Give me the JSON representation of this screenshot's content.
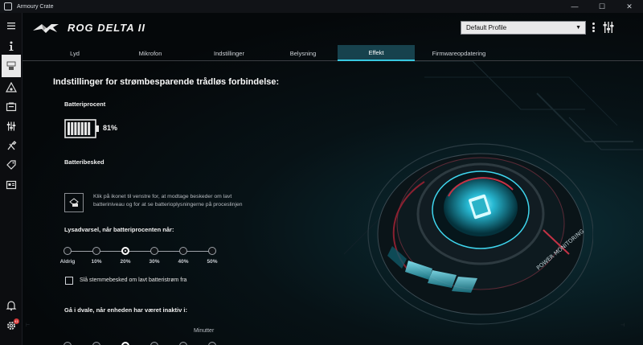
{
  "window": {
    "title": "Armoury Crate",
    "minimize": "—",
    "maximize": "☐",
    "close": "✕"
  },
  "header": {
    "product_title": "ROG DELTA II",
    "profile": "Default Profile"
  },
  "sidebar": {
    "badge_count": "41"
  },
  "tabs": [
    {
      "label": "Lyd"
    },
    {
      "label": "Mikrofon"
    },
    {
      "label": "Indstillinger"
    },
    {
      "label": "Belysning"
    },
    {
      "label": "Effekt"
    },
    {
      "label": "Firmwareopdatering"
    }
  ],
  "active_tab": "Effekt",
  "content": {
    "section_title": "Indstillinger for strømbesparende trådløs forbindelse:",
    "battery_label": "Batteriprocent",
    "battery_percent": "81%",
    "battery_level": 0.81,
    "battery_message_label": "Batteribesked",
    "battery_message_text": "Klik på ikonet til venstre for, at modtage beskeder om lavt batteriniveau og for at se batterioplysningerne på proceslinjen",
    "light_warning_label": "Lysadvarsel, når batteriprocenten når:",
    "light_warning_options": [
      "Aldrig",
      "10%",
      "20%",
      "30%",
      "40%",
      "50%"
    ],
    "light_warning_selected": "20%",
    "voice_checkbox_label": "Slå stemmebesked om lavt batteristrøm fra",
    "voice_checkbox_checked": false,
    "sleep_label": "Gå i dvale, når enheden har været inaktiv i:",
    "sleep_unit": "Minutter",
    "device_text": "POWER MONITORING"
  },
  "colors": {
    "accent": "#38c8e0",
    "tab_active_bg": "#17424d",
    "badge": "#d83b3b"
  }
}
